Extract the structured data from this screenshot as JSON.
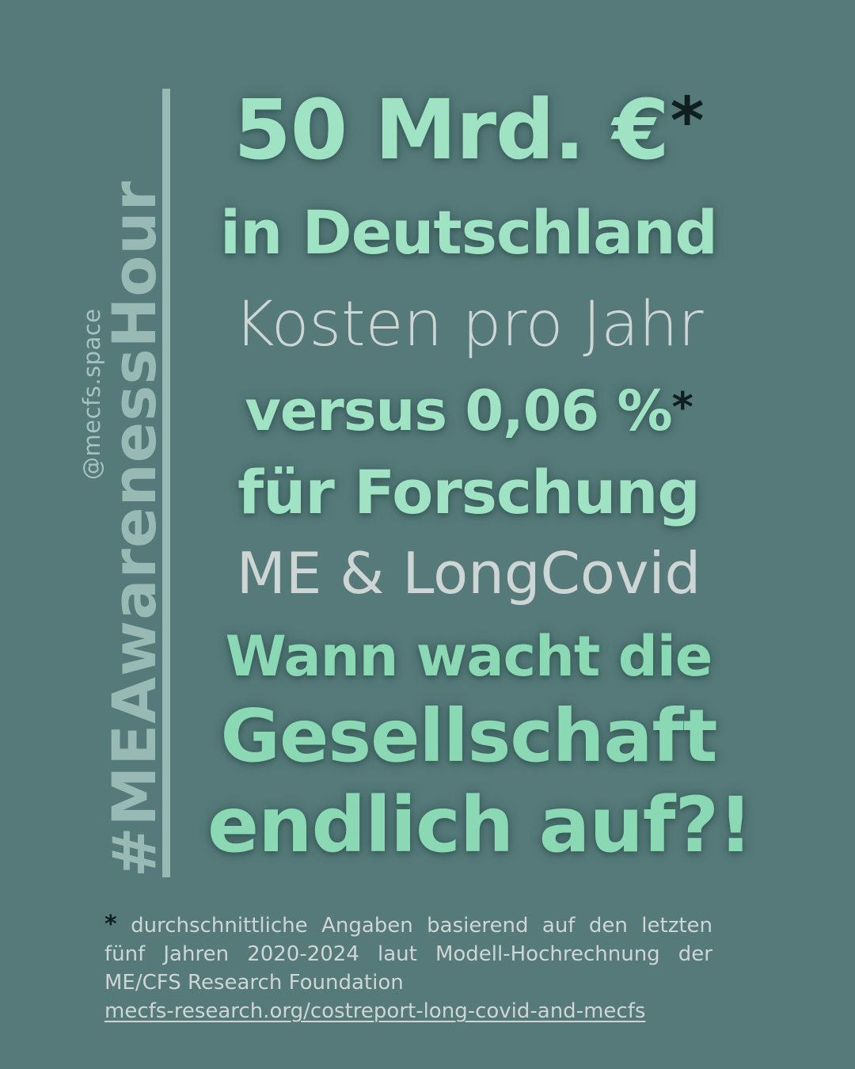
{
  "side": {
    "hashtag": "#MEAwarenessHour",
    "handle": "@mecfs.space"
  },
  "headline": {
    "amount": "50 Mrd. €",
    "amount_mark": "*",
    "region": "in Deutschland",
    "cost_label": "Kosten pro Jahr",
    "versus": "versus 0,06 %",
    "versus_mark": "*",
    "research": "für Forschung",
    "diseases": "ME & LongCovid",
    "question_line1": "Wann wacht die",
    "question_line2": "Gesellschaft",
    "question_line3": "endlich auf?!"
  },
  "footnote": {
    "mark": "*",
    "text": "durchschnittliche Angaben basierend auf den letzten fünf Jahren 2020-2024 laut Modell-Hochrechnung der ME/CFS Research Foundation",
    "link": "mecfs-research.org/costreport-long-covid-and-mecfs"
  },
  "colors": {
    "background": "#557a79",
    "headline_green": "#9fe2c4",
    "light_text": "#cdd6d5",
    "side_text": "#99b9b5",
    "asterisk": "#0f1f1f"
  }
}
